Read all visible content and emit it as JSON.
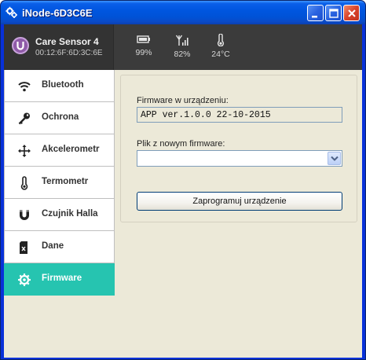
{
  "window": {
    "title": "iNode-6D3C6E"
  },
  "device": {
    "name": "Care Sensor 4",
    "mac": "00:12:6F:6D:3C:6E"
  },
  "status": {
    "battery": "99%",
    "signal": "82%",
    "temperature": "24°C"
  },
  "sidebar": {
    "items": [
      {
        "label": "Bluetooth",
        "icon": "wifi-icon"
      },
      {
        "label": "Ochrona",
        "icon": "key-icon"
      },
      {
        "label": "Akcelerometr",
        "icon": "move-arrows-icon"
      },
      {
        "label": "Termometr",
        "icon": "thermometer-icon"
      },
      {
        "label": "Czujnik Halla",
        "icon": "magnet-icon"
      },
      {
        "label": "Dane",
        "icon": "sd-card-icon"
      },
      {
        "label": "Firmware",
        "icon": "gear-icon"
      }
    ],
    "active": "Firmware"
  },
  "firmware": {
    "current_label": "Firmware w urządzeniu:",
    "current_value": "APP ver.1.0.0  22-10-2015",
    "file_label": "Plik z nowym firmware:",
    "file_value": "",
    "program_button": "Zaprogramuj urządzenie"
  },
  "colors": {
    "accent": "#26c4b0",
    "header_bg": "#3b3b3b",
    "titlebar": "#0054e3"
  }
}
